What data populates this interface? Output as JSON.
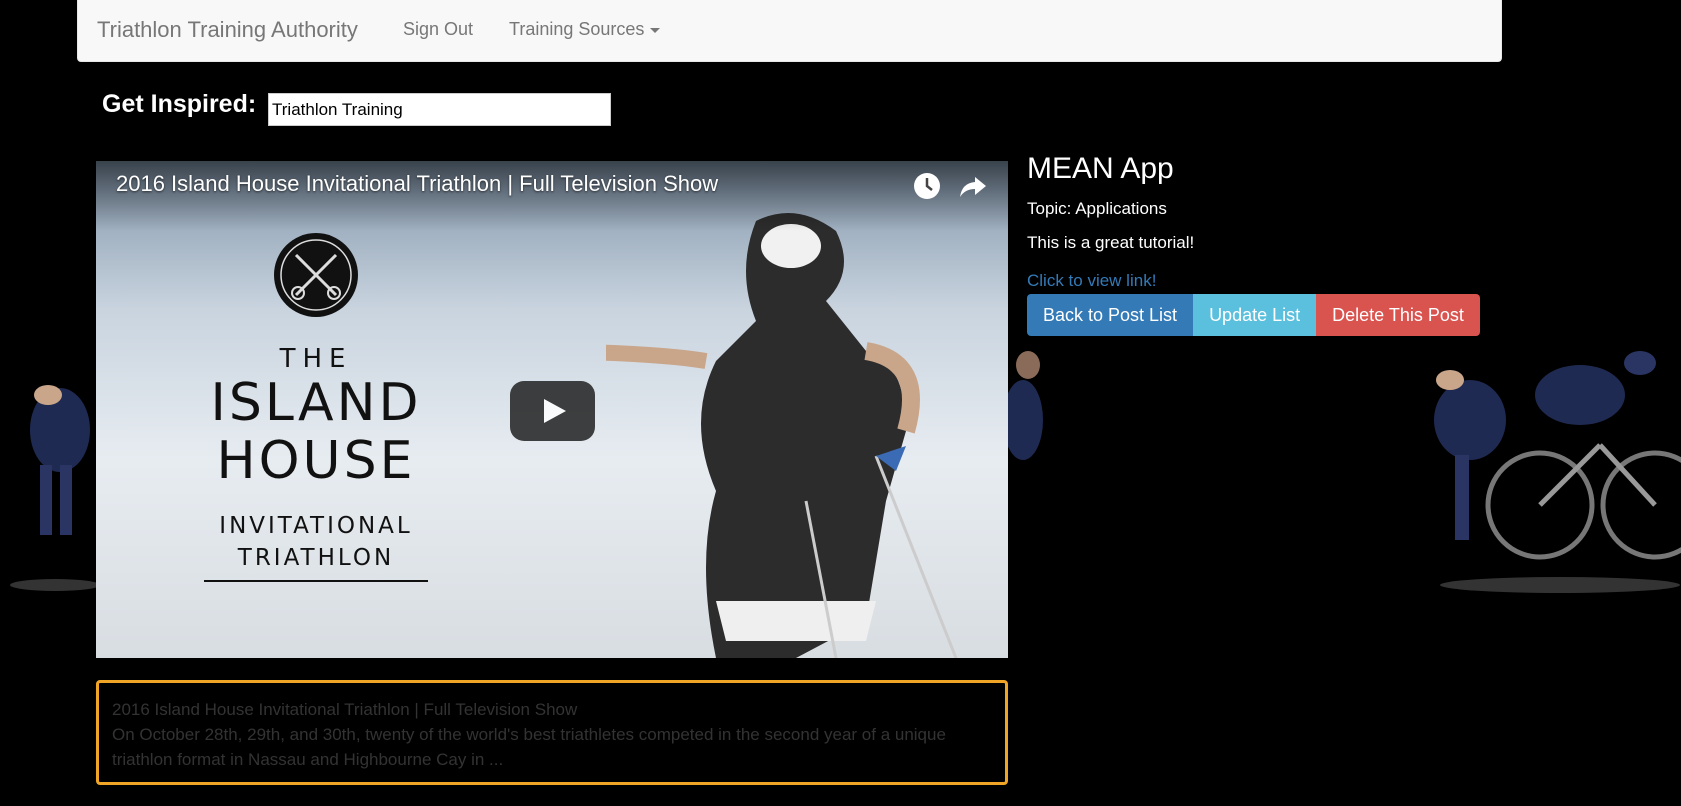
{
  "navbar": {
    "brand": "Triathlon Training Authority",
    "sign_out": "Sign Out",
    "training_sources": "Training Sources"
  },
  "search": {
    "label": "Get Inspired:",
    "value": "Triathlon Training"
  },
  "video": {
    "title": "2016 Island House Invitational Triathlon | Full Television Show",
    "logo_the": "THE",
    "logo_island": "ISLAND",
    "logo_house": "HOUSE",
    "logo_invitational": "INVITATIONAL",
    "logo_triathlon": "TRIATHLON"
  },
  "post": {
    "title": "MEAN App",
    "topic": "Topic: Applications",
    "description": "This is a great tutorial!",
    "link_text": "Click to view link!"
  },
  "buttons": {
    "back": "Back to Post List",
    "update": "Update List",
    "delete": "Delete This Post"
  },
  "video_info": {
    "title": "2016 Island House Invitational Triathlon | Full Television Show",
    "description": "On October 28th, 29th, and 30th, twenty of the world's best triathletes competed in the second year of a unique triathlon format in Nassau and Highbourne Cay in ..."
  },
  "colors": {
    "primary": "#337ab7",
    "info": "#5bc0de",
    "danger": "#d9534f",
    "highlight_border": "#f0a526"
  }
}
